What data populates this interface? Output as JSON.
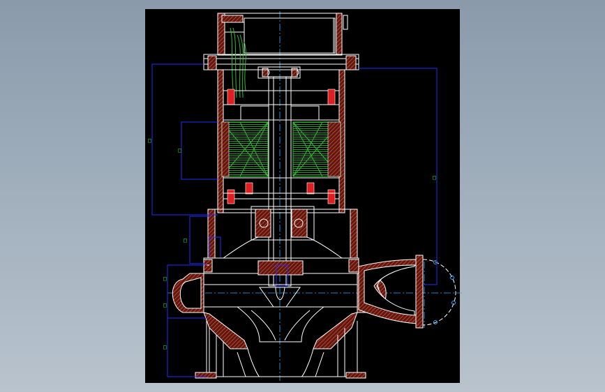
{
  "drawing": {
    "colors": {
      "background": "#000000",
      "outline": "#ffffff",
      "section_hatch": "#a83a2a",
      "winding": "#2ec02e",
      "dimension": "#2030ff",
      "centerline": "#33aaff",
      "seal": "#e02020",
      "bolt_circle": "#ffffff"
    },
    "dimension_labels": [
      "□",
      "□",
      "□",
      "□",
      "□",
      "□",
      "□"
    ]
  }
}
